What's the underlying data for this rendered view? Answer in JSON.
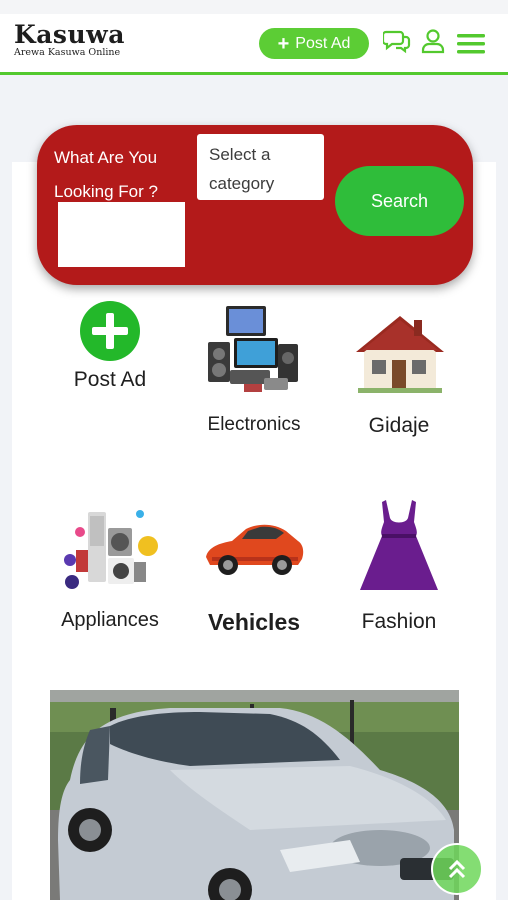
{
  "header": {
    "logo_title": "Kasuwa",
    "logo_subtitle": "Arewa Kasuwa Online",
    "post_ad_label": "Post Ad"
  },
  "search": {
    "question_line1": "What Are You",
    "question_line2": "Looking For ?",
    "category_line1": "Select a",
    "category_line2": "category",
    "button_label": "Search"
  },
  "categories": [
    {
      "label": "Post Ad",
      "icon": "plus-circle-icon"
    },
    {
      "label": "Electronics",
      "icon": "electronics-icon"
    },
    {
      "label": "Gidaje",
      "icon": "house-icon"
    },
    {
      "label": "Appliances",
      "icon": "appliances-icon"
    },
    {
      "label": "Vehicles",
      "icon": "sports-car-icon"
    },
    {
      "label": "Fashion",
      "icon": "dress-icon"
    }
  ],
  "colors": {
    "brand_green": "#5ccd35",
    "panel_red": "#b31a1a",
    "search_green": "#2fbd3a",
    "dress_purple": "#6a1d8e"
  }
}
